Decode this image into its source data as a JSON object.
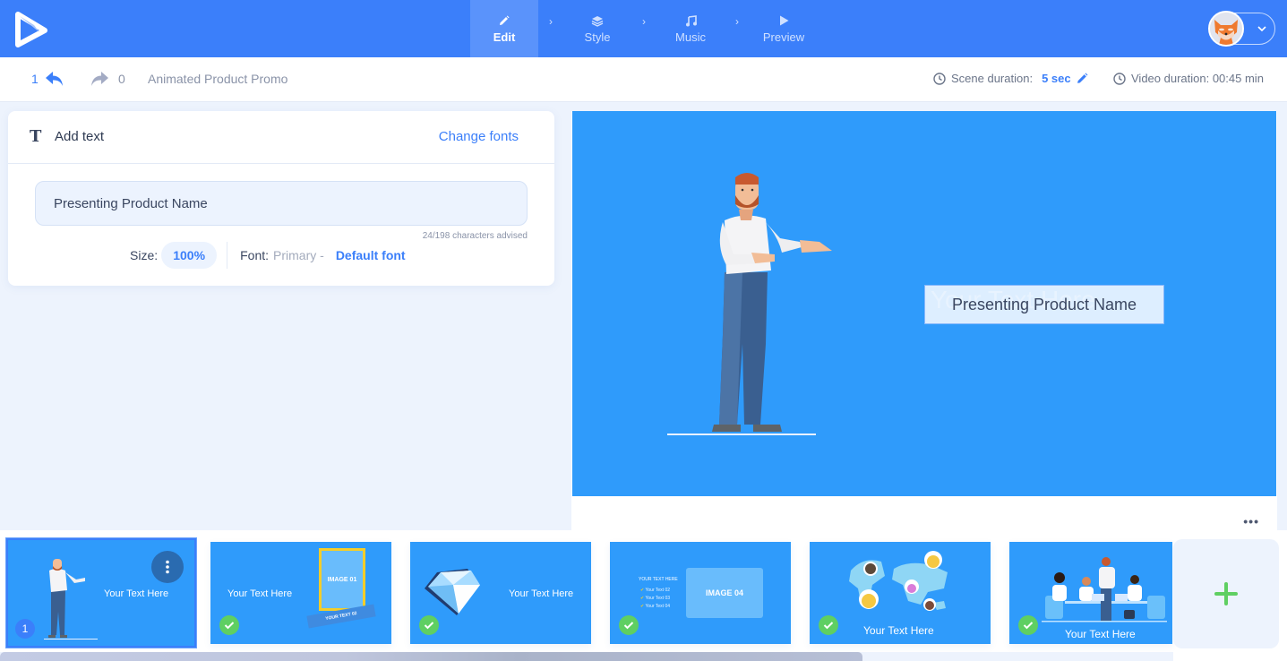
{
  "app": {
    "logo": "play-logo-icon"
  },
  "steps": [
    {
      "label": "Edit",
      "icon": "pencil-icon",
      "active": true
    },
    {
      "label": "Style",
      "icon": "layers-icon",
      "active": false
    },
    {
      "label": "Music",
      "icon": "music-note-icon",
      "active": false
    },
    {
      "label": "Preview",
      "icon": "play-icon",
      "active": false
    }
  ],
  "step_separator": "›",
  "user": {
    "avatar": "fox-avatar",
    "menu_icon": "chevron-down-icon"
  },
  "toolbar": {
    "undo_count": "1",
    "redo_count": "0",
    "project_title": "Animated Product Promo",
    "scene_duration_label": "Scene duration:",
    "scene_duration_value": "5 sec",
    "video_duration_label": "Video duration: 00:45 min"
  },
  "text_panel": {
    "title": "Add text",
    "change_fonts": "Change fonts",
    "input_value": "Presenting Product Name",
    "char_count": "24/198 characters advised",
    "size_label": "Size:",
    "size_value": "100%",
    "font_label": "Font:",
    "font_primary": "Primary -",
    "font_value": "Default font"
  },
  "preview": {
    "ghost_text": "Your Text Here",
    "text_box": "Presenting Product Name",
    "more": "•••",
    "bg_color": "#2f9bfb"
  },
  "scenes": [
    {
      "number": "1",
      "label": "Your Text Here",
      "active": true,
      "done": false
    },
    {
      "label": "Your Text Here",
      "image_label": "IMAGE 01",
      "ribbon": "YOUR TEXT 02",
      "done": true
    },
    {
      "label": "Your Text Here",
      "done": true
    },
    {
      "heading": "YOUR TEXT HERE",
      "list": [
        "Your Text 02",
        "Your Text 03",
        "Your Text 04"
      ],
      "image_label": "IMAGE 04",
      "done": true
    },
    {
      "label": "Your Text Here",
      "done": true
    },
    {
      "label": "Your Text Here",
      "done": true
    }
  ],
  "add_scene": "+",
  "colors": {
    "brand": "#3b7ffa",
    "check": "#5fcf62",
    "add": "#5fcf62"
  }
}
